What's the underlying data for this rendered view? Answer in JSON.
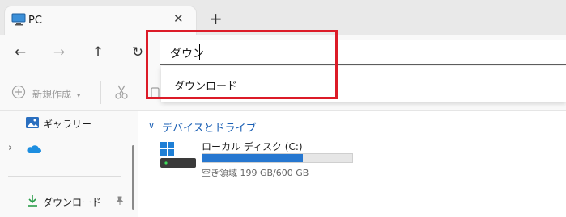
{
  "tab": {
    "title": "PC",
    "close": "✕",
    "new_tab": "+"
  },
  "nav": {
    "back": "←",
    "forward": "→",
    "up": "↑",
    "refresh": "↻"
  },
  "search": {
    "value": "ダウン",
    "suggestion": "ダウンロード"
  },
  "command_bar": {
    "new_label": "新規作成"
  },
  "sidebar": {
    "items": [
      {
        "label": "ギャラリー",
        "icon": "gallery-icon"
      },
      {
        "label": "",
        "icon": "onedrive-icon"
      },
      {
        "label": "ダウンロード",
        "icon": "download-icon"
      }
    ]
  },
  "main": {
    "group_header": "デバイスとドライブ",
    "drive": {
      "name": "ローカル ディスク (C:)",
      "free_text": "空き領域 199 GB/600 GB",
      "used_fraction": 0.67
    }
  },
  "colors": {
    "accent": "#2677d0",
    "highlight": "#dc1b28"
  }
}
